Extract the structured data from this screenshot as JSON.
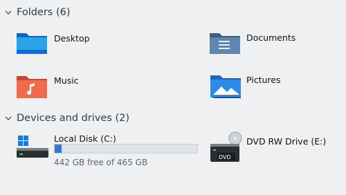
{
  "sections": {
    "folders": {
      "label": "Folders (6)"
    },
    "devices": {
      "label": "Devices and drives (2)"
    }
  },
  "folders": [
    {
      "name": "Desktop",
      "icon": "desktop-folder-icon"
    },
    {
      "name": "Documents",
      "icon": "documents-folder-icon"
    },
    {
      "name": "Music",
      "icon": "music-folder-icon"
    },
    {
      "name": "Pictures",
      "icon": "pictures-folder-icon"
    }
  ],
  "drives": [
    {
      "name": "Local Disk (C:)",
      "icon": "local-disk-icon",
      "free_text": "442 GB free of 465 GB",
      "used_fraction": 0.049
    },
    {
      "name": "DVD RW Drive (E:)",
      "icon": "dvd-drive-icon",
      "badge": "DVD"
    }
  ],
  "colors": {
    "background": "#eef0f1",
    "progress_fill": "#2f7ad6",
    "folder_blue": "#1e7fd8"
  }
}
